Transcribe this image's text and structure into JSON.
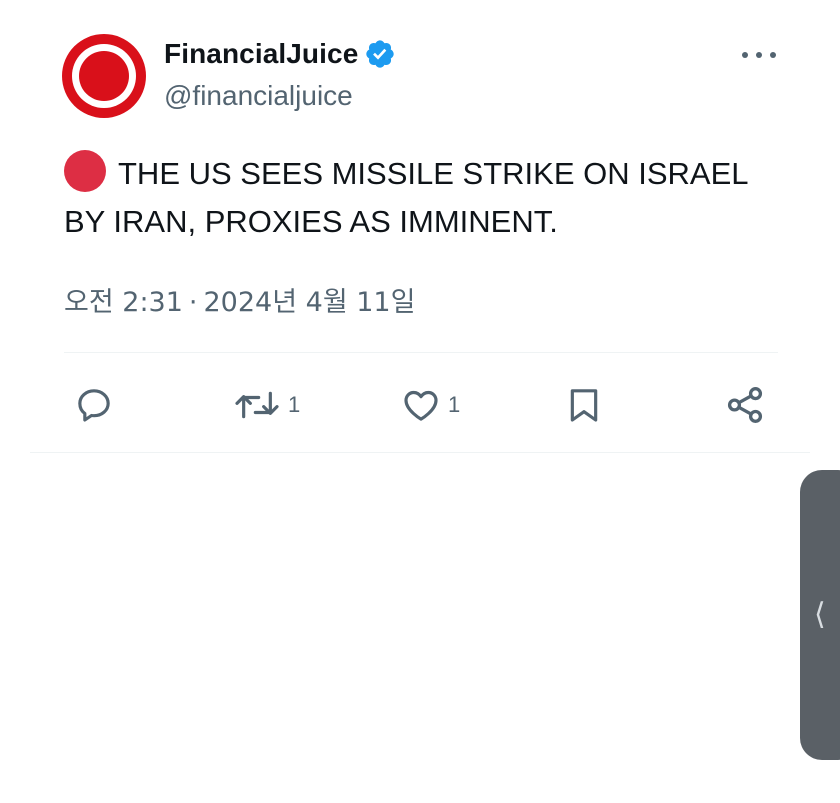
{
  "author": {
    "display_name": "FinancialJuice",
    "handle": "@financialjuice",
    "verified_icon": "verified-badge-icon",
    "avatar_color": "#d9101a",
    "verified_color": "#1d9bf0"
  },
  "tweet": {
    "emoji_icon": "red-circle-emoji",
    "text": "THE US SEES MISSILE STRIKE ON ISRAEL BY IRAN, PROXIES AS IMMINENT.",
    "time": "오전 2:31",
    "separator": "·",
    "date": "2024년 4월 11일"
  },
  "actions": {
    "reply_icon": "reply-icon",
    "retweet_icon": "retweet-icon",
    "retweet_count": "1",
    "like_icon": "heart-icon",
    "like_count": "1",
    "bookmark_icon": "bookmark-icon",
    "share_icon": "share-icon"
  },
  "side_handle": {
    "chevron": "⟨"
  }
}
